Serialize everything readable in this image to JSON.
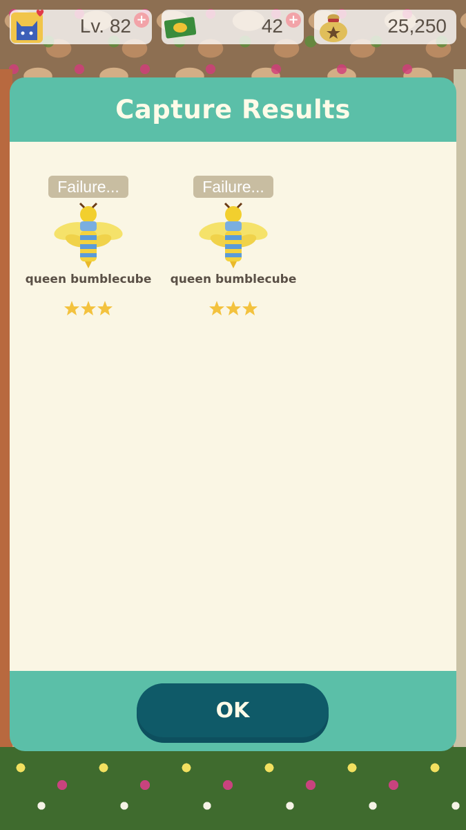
{
  "hud": {
    "level": "Lv. 82",
    "tickets": "42",
    "bells": "25,250",
    "plus_symbol": "+"
  },
  "dialog": {
    "title": "Capture Results",
    "results": [
      {
        "status": "Failure...",
        "name": "queen bumblecube",
        "stars": 3
      },
      {
        "status": "Failure...",
        "name": "queen bumblecube",
        "stars": 3
      }
    ],
    "ok_label": "OK"
  },
  "colors": {
    "dialog_teal": "#5bbfa8",
    "body_cream": "#faf6e4",
    "button_teal": "#0f5a68",
    "badge_tan": "#c8bda1",
    "star_gold": "#f3c23e"
  },
  "icons": {
    "level": "cat-face-icon",
    "tickets": "leaf-ticket-icon",
    "bells": "bell-bag-icon",
    "bug": "bee-icon",
    "rating": "star-icon"
  }
}
